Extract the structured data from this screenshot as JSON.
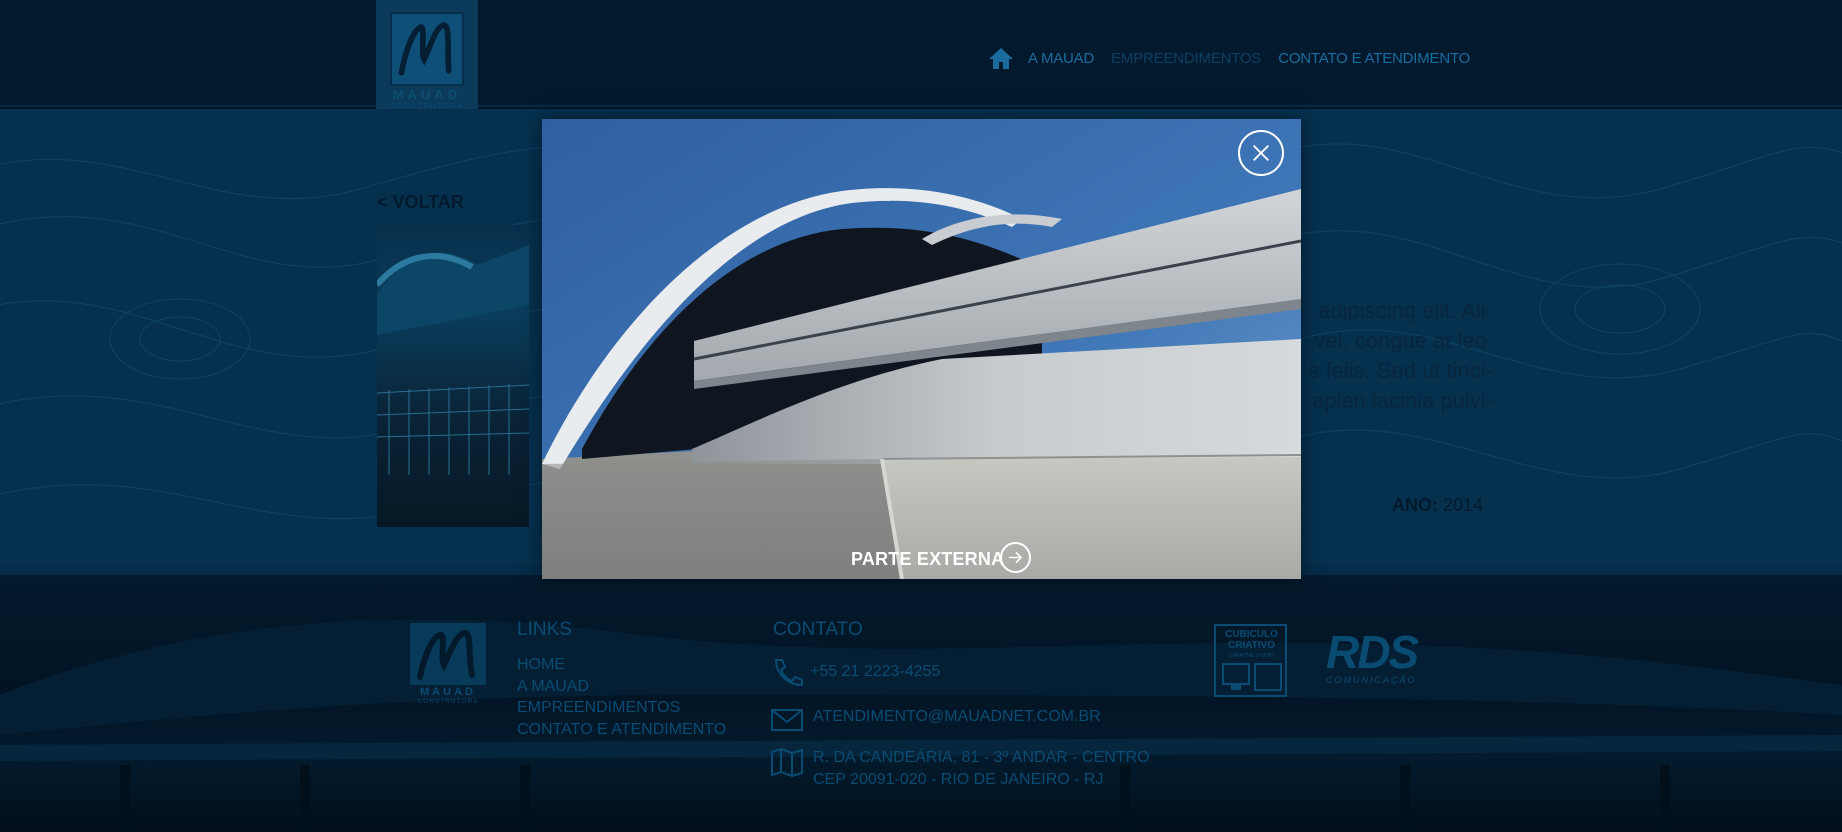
{
  "brand": {
    "name": "MAUAD",
    "subtitle": "CONSTRUTORA"
  },
  "nav": {
    "items": [
      {
        "label": "A MAUAD"
      },
      {
        "label": "EMPREENDIMENTOS"
      },
      {
        "label": "CONTATO E ATENDIMENTO"
      }
    ]
  },
  "main": {
    "back_label": "< VOLTAR",
    "description_lines": [
      "adipiscing elit. Ali-",
      "vel, congue at leo.",
      "s felis. Sed ut tinci-",
      "apien lacinia pulvi-"
    ],
    "year_label": "ANO:",
    "year_value": "2014"
  },
  "modal": {
    "caption": "PARTE EXTERNA",
    "close_icon": "close-icon",
    "next_icon": "arrow-right-icon"
  },
  "footer": {
    "links_title": "LINKS",
    "links": [
      "HOME",
      "A MAUAD",
      "EMPREENDIMENTOS",
      "CONTATO E ATENDIMENTO"
    ],
    "contact_title": "CONTATO",
    "phone": "+55 21 2223-4255",
    "email": "ATENDIMENTO@MAUADNET.COM.BR",
    "address_line1": "R. DA CANDEÁRIA, 81 - 3º ANDAR - CENTRO",
    "address_line2": "CEP 20091-020 - RIO DE JANEIRO - RJ",
    "partner1_line1": "CUBICULO",
    "partner1_line2": "CRIATIVO",
    "partner1_tag": "CREATIVE STUDIO",
    "partner2_name": "RDS",
    "partner2_sub": "COMUNICAÇÃO"
  },
  "colors": {
    "overlay_bg": "#021727",
    "accent": "#1b6c9e",
    "text_white": "#ffffff"
  }
}
